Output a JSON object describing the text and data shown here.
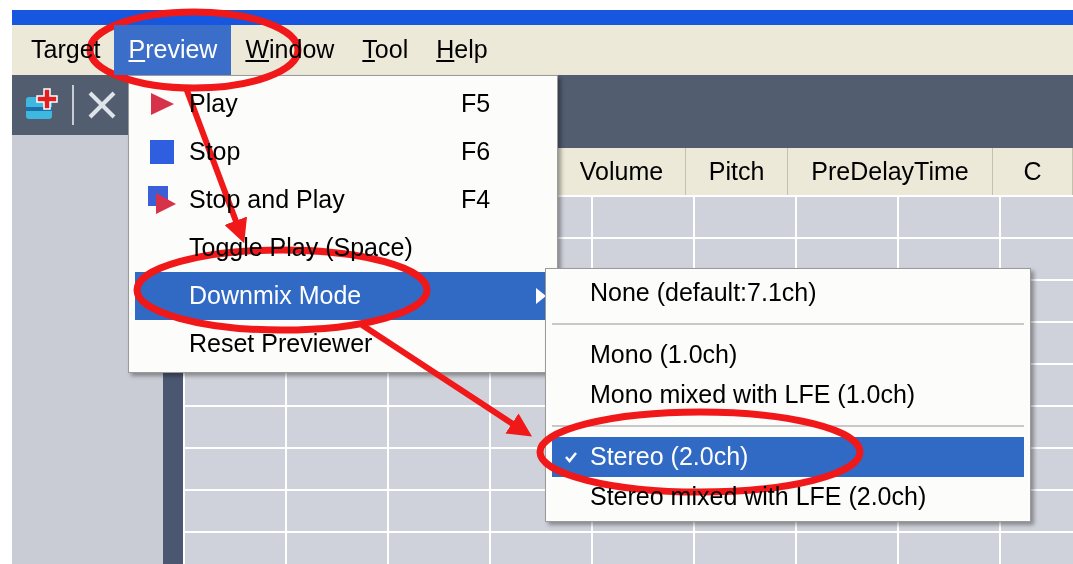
{
  "menu_bar": [
    {
      "label": "Target",
      "selected": false,
      "mnemonic": false
    },
    {
      "label": "Preview",
      "selected": true,
      "mnemonic": true
    },
    {
      "label": "Window",
      "selected": false,
      "mnemonic": true
    },
    {
      "label": "Tool",
      "selected": false,
      "mnemonic": true
    },
    {
      "label": "Help",
      "selected": false,
      "mnemonic": true
    }
  ],
  "table": {
    "columns": [
      {},
      {
        "label": "Volume"
      },
      {
        "label": "Pitch"
      },
      {
        "label": "PreDelayTime"
      },
      {
        "label": "C"
      }
    ]
  },
  "preview_menu": {
    "items": [
      {
        "kind": "play",
        "label": "Play",
        "shortcut": "F5",
        "selected": false
      },
      {
        "kind": "stop",
        "label": "Stop",
        "shortcut": "F6",
        "selected": false
      },
      {
        "kind": "stopplay",
        "label": "Stop and Play",
        "shortcut": "F4",
        "selected": false
      },
      {
        "kind": "plain",
        "label": "Toggle Play (Space)",
        "selected": false
      },
      {
        "kind": "submenu",
        "label": "Downmix Mode",
        "selected": true
      },
      {
        "kind": "plain",
        "label": "Reset Previewer",
        "selected": false
      }
    ]
  },
  "downmix_menu": {
    "items": [
      {
        "kind": "option",
        "label": "None (default:7.1ch)",
        "checked": false,
        "selected": false
      },
      {
        "kind": "separator"
      },
      {
        "kind": "option",
        "label": "Mono (1.0ch)",
        "checked": false,
        "selected": false
      },
      {
        "kind": "option",
        "label": "Mono mixed with LFE (1.0ch)",
        "checked": false,
        "selected": false
      },
      {
        "kind": "separator"
      },
      {
        "kind": "option",
        "label": "Stereo (2.0ch)",
        "checked": true,
        "selected": true
      },
      {
        "kind": "option",
        "label": "Stereo mixed with LFE (2.0ch)",
        "checked": false,
        "selected": false
      }
    ]
  }
}
